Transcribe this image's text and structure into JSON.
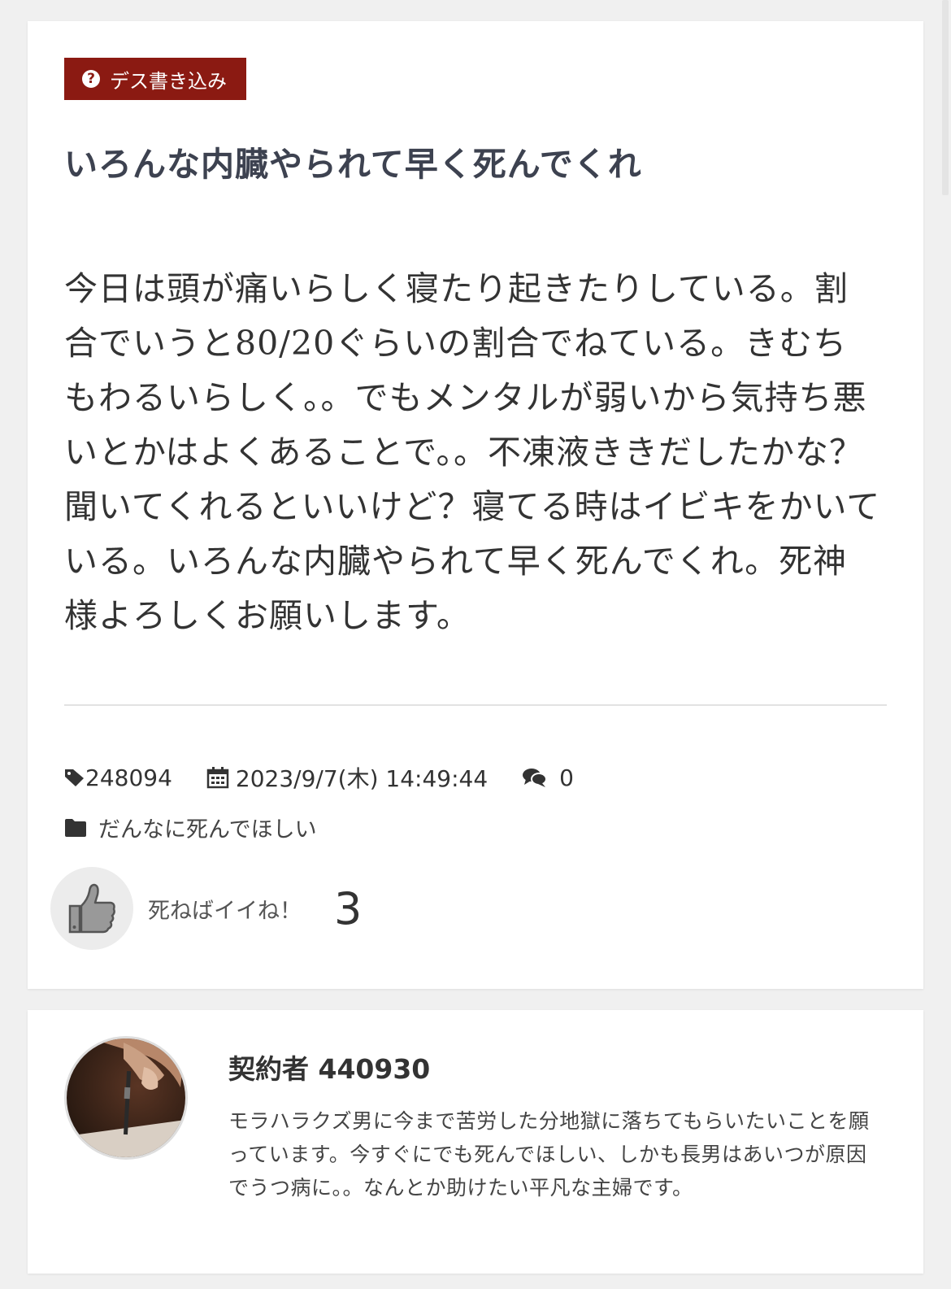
{
  "post": {
    "category_badge": "デス書き込み",
    "title": "いろんな内臓やられて早く死んでくれ",
    "body": "今日は頭が痛いらしく寝たり起きたりしている。割合でいうと80/20ぐらいの割合でねている。きむちもわるいらしく。。でもメンタルが弱いから気持ち悪いとかはよくあることで。。不凍液ききだしたかな？聞いてくれるといいけど？寝てる時はイビキをかいている。いろんな内臓やられて早く死んでくれ。死神様よろしくお願いします。",
    "post_id": "248094",
    "datetime": "2023/9/7(木) 14:49:44",
    "comment_count": "0",
    "category": "だんなに死んでほしい",
    "like_label": "死ねばイイね！",
    "like_count": "3"
  },
  "author": {
    "name": "契約者 440930",
    "bio": "モラハラクズ男に今まで苦労した分地獄に落ちてもらいたいことを願っています。今すぐにでも死んでほしい、しかも長男はあいつが原因でうつ病に。。なんとか助けたい平凡な主婦です。"
  },
  "colors": {
    "badge_bg": "#8b1a12",
    "title": "#3d4250",
    "page_bg": "#f0f0f0"
  },
  "icons": {
    "badge": "question-circle-icon",
    "post_id": "tag-icon",
    "datetime": "calendar-icon",
    "comments": "comments-icon",
    "category": "folder-icon",
    "like": "thumbs-up-icon"
  }
}
